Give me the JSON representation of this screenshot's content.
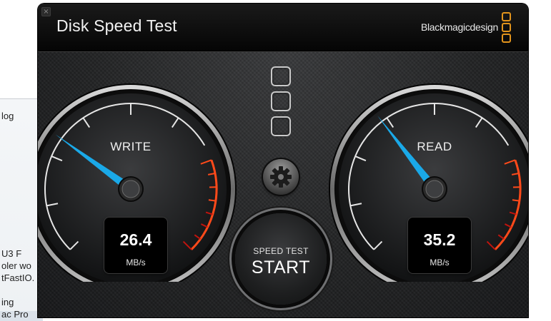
{
  "background_window": {
    "fragments": [
      "log",
      "U3 F",
      "oler wo",
      "tFastIO.",
      "ing",
      "ac Pro"
    ]
  },
  "window": {
    "title": "Disk Speed Test",
    "close_glyph": "×",
    "brand": "Blackmagicdesign",
    "brand_mark_color": "#e2941c"
  },
  "gauges": {
    "write": {
      "label": "WRITE",
      "value": "26.4",
      "unit": "MB/s",
      "needle_fraction": 0.3
    },
    "read": {
      "label": "READ",
      "value": "35.2",
      "unit": "MB/s",
      "needle_fraction": 0.36
    }
  },
  "center": {
    "indicator_slots": 3,
    "settings_icon": "gear-icon",
    "start_button": {
      "small_label": "SPEED TEST",
      "big_label": "START"
    }
  },
  "colors": {
    "needle": "#1aa9e8",
    "redline_start": "#ff4a1a",
    "redline_end": "#c0140e"
  }
}
